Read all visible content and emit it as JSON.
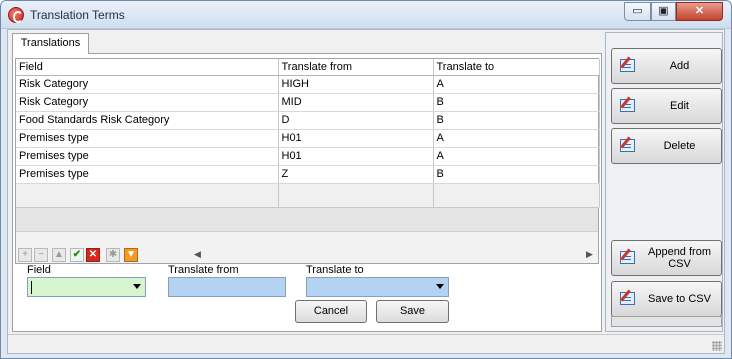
{
  "window": {
    "title": "Translation Terms",
    "controls": {
      "minimize": "▭",
      "maximize": "▣",
      "close": "✕"
    }
  },
  "tabs": [
    {
      "label": "Translations",
      "active": true
    }
  ],
  "grid": {
    "columns": [
      "Field",
      "Translate from",
      "Translate to"
    ],
    "rows": [
      {
        "field": "Risk Category",
        "from": "HIGH",
        "to": "A"
      },
      {
        "field": "Risk Category",
        "from": "MID",
        "to": "B"
      },
      {
        "field": "Food Standards Risk Category",
        "from": "D",
        "to": "B"
      },
      {
        "field": "Premises type",
        "from": "H01",
        "to": "A"
      },
      {
        "field": "Premises type",
        "from": "H01",
        "to": "A"
      },
      {
        "field": "Premises type",
        "from": "Z",
        "to": "B"
      }
    ],
    "navigator_icons": [
      "plus-icon",
      "minus-icon",
      "up-icon",
      "check-icon",
      "cross-icon",
      "asterisk-icon",
      "filter-icon"
    ]
  },
  "form": {
    "field_label": "Field",
    "field_value": "",
    "translate_from_label": "Translate from",
    "translate_from_value": "",
    "translate_to_label": "Translate to",
    "translate_to_value": "",
    "cancel_label": "Cancel",
    "save_label": "Save"
  },
  "side_buttons": {
    "add": "Add",
    "edit": "Edit",
    "delete": "Delete",
    "append": "Append from CSV",
    "save_csv": "Save to CSV"
  },
  "colors": {
    "field_combo_bg": "#d4f5d0",
    "translate_inputs_bg": "#b4d3f3",
    "close_button": "#c2432f"
  }
}
